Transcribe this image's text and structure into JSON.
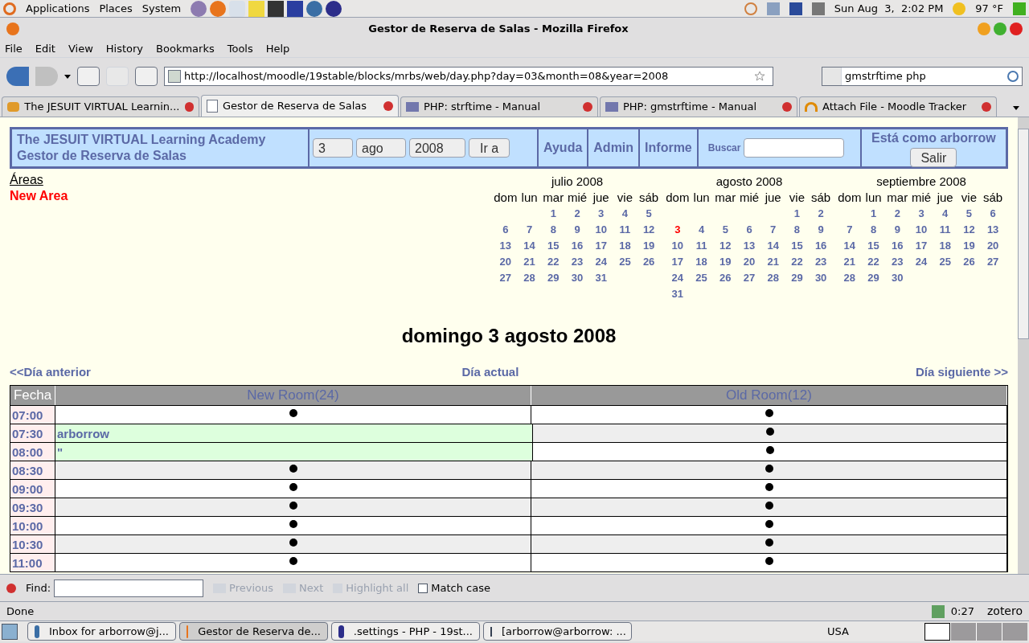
{
  "top_panel": {
    "menus": [
      "Applications",
      "Places",
      "System"
    ],
    "clock": "Sun Aug  3,  2:02 PM",
    "weather": "97 °F"
  },
  "window": {
    "title": "Gestor de Reserva de Salas - Mozilla Firefox"
  },
  "menubar": [
    "File",
    "Edit",
    "View",
    "History",
    "Bookmarks",
    "Tools",
    "Help"
  ],
  "toolbar": {
    "url": "http://localhost/moodle/19stable/blocks/mrbs/web/day.php?day=03&month=08&year=2008",
    "search_value": "gmstrftime php"
  },
  "tabs": [
    {
      "label": "The JESUIT VIRTUAL Learnin...",
      "selected": false
    },
    {
      "label": "Gestor de Reserva de Salas",
      "selected": true
    },
    {
      "label": "PHP: strftime - Manual",
      "selected": false
    },
    {
      "label": "PHP: gmstrftime - Manual",
      "selected": false
    },
    {
      "label": "Attach File - Moodle Tracker",
      "selected": false
    }
  ],
  "header": {
    "site": "The JESUIT VIRTUAL Learning Academy",
    "app": "Gestor de Reserva de Salas",
    "day": "3",
    "month": "ago",
    "year": "2008",
    "go": "Ir a",
    "links": [
      "Ayuda",
      "Admin",
      "Informe"
    ],
    "search_label": "Buscar",
    "user": "Está como arborrow",
    "logout": "Salir"
  },
  "areas": {
    "title": "Áreas",
    "items": [
      "New Area"
    ]
  },
  "calendars": [
    {
      "title": "julio 2008",
      "weekdays": [
        "dom",
        "lun",
        "mar",
        "mié",
        "jue",
        "vie",
        "sáb"
      ],
      "weeks": [
        [
          {
            "day": "1",
            "today": false
          },
          {
            "day": "2",
            "today": false
          },
          {
            "day": "3",
            "today": false
          },
          {
            "day": "4",
            "today": false
          },
          {
            "day": "5",
            "today": false
          }
        ],
        [
          {
            "day": "6",
            "today": false
          },
          {
            "day": "7",
            "today": false
          },
          {
            "day": "8",
            "today": false
          },
          {
            "day": "9",
            "today": false
          },
          {
            "day": "10",
            "today": false
          },
          {
            "day": "11",
            "today": false
          },
          {
            "day": "12",
            "today": false
          }
        ],
        [
          {
            "day": "13",
            "today": false
          },
          {
            "day": "14",
            "today": false
          },
          {
            "day": "15",
            "today": false
          },
          {
            "day": "16",
            "today": false
          },
          {
            "day": "17",
            "today": false
          },
          {
            "day": "18",
            "today": false
          },
          {
            "day": "19",
            "today": false
          }
        ],
        [
          {
            "day": "20",
            "today": false
          },
          {
            "day": "21",
            "today": false
          },
          {
            "day": "22",
            "today": false
          },
          {
            "day": "23",
            "today": false
          },
          {
            "day": "24",
            "today": false
          },
          {
            "day": "25",
            "today": false
          },
          {
            "day": "26",
            "today": false
          }
        ],
        [
          {
            "day": "27",
            "today": false
          },
          {
            "day": "28",
            "today": false
          },
          {
            "day": "29",
            "today": false
          },
          {
            "day": "30",
            "today": false
          },
          {
            "day": "31",
            "today": false
          }
        ]
      ]
    },
    {
      "title": "agosto 2008",
      "weekdays": [
        "dom",
        "lun",
        "mar",
        "mié",
        "jue",
        "vie",
        "sáb"
      ],
      "weeks": [
        [
          {
            "day": "1",
            "today": false
          },
          {
            "day": "2",
            "today": false
          }
        ],
        [
          {
            "day": "3",
            "today": true
          },
          {
            "day": "4",
            "today": false
          },
          {
            "day": "5",
            "today": false
          },
          {
            "day": "6",
            "today": false
          },
          {
            "day": "7",
            "today": false
          },
          {
            "day": "8",
            "today": false
          },
          {
            "day": "9",
            "today": false
          }
        ],
        [
          {
            "day": "10",
            "today": false
          },
          {
            "day": "11",
            "today": false
          },
          {
            "day": "12",
            "today": false
          },
          {
            "day": "13",
            "today": false
          },
          {
            "day": "14",
            "today": false
          },
          {
            "day": "15",
            "today": false
          },
          {
            "day": "16",
            "today": false
          }
        ],
        [
          {
            "day": "17",
            "today": false
          },
          {
            "day": "18",
            "today": false
          },
          {
            "day": "19",
            "today": false
          },
          {
            "day": "20",
            "today": false
          },
          {
            "day": "21",
            "today": false
          },
          {
            "day": "22",
            "today": false
          },
          {
            "day": "23",
            "today": false
          }
        ],
        [
          {
            "day": "24",
            "today": false
          },
          {
            "day": "25",
            "today": false
          },
          {
            "day": "26",
            "today": false
          },
          {
            "day": "27",
            "today": false
          },
          {
            "day": "28",
            "today": false
          },
          {
            "day": "29",
            "today": false
          },
          {
            "day": "30",
            "today": false
          }
        ],
        [
          {
            "day": "31",
            "today": false
          }
        ]
      ]
    },
    {
      "title": "septiembre 2008",
      "weekdays": [
        "dom",
        "lun",
        "mar",
        "mié",
        "jue",
        "vie",
        "sáb"
      ],
      "weeks": [
        [
          {
            "day": "1",
            "today": false
          },
          {
            "day": "2",
            "today": false
          },
          {
            "day": "3",
            "today": false
          },
          {
            "day": "4",
            "today": false
          },
          {
            "day": "5",
            "today": false
          },
          {
            "day": "6",
            "today": false
          }
        ],
        [
          {
            "day": "7",
            "today": false
          },
          {
            "day": "8",
            "today": false
          },
          {
            "day": "9",
            "today": false
          },
          {
            "day": "10",
            "today": false
          },
          {
            "day": "11",
            "today": false
          },
          {
            "day": "12",
            "today": false
          },
          {
            "day": "13",
            "today": false
          }
        ],
        [
          {
            "day": "14",
            "today": false
          },
          {
            "day": "15",
            "today": false
          },
          {
            "day": "16",
            "today": false
          },
          {
            "day": "17",
            "today": false
          },
          {
            "day": "18",
            "today": false
          },
          {
            "day": "19",
            "today": false
          },
          {
            "day": "20",
            "today": false
          }
        ],
        [
          {
            "day": "21",
            "today": false
          },
          {
            "day": "22",
            "today": false
          },
          {
            "day": "23",
            "today": false
          },
          {
            "day": "24",
            "today": false
          },
          {
            "day": "25",
            "today": false
          },
          {
            "day": "26",
            "today": false
          },
          {
            "day": "27",
            "today": false
          }
        ],
        [
          {
            "day": "28",
            "today": false
          },
          {
            "day": "29",
            "today": false
          },
          {
            "day": "30",
            "today": false
          }
        ]
      ]
    }
  ],
  "day_title": "domingo 3 agosto 2008",
  "day_nav": {
    "prev": "<<Día anterior",
    "today": "Día actual",
    "next": "Día siguiente >>"
  },
  "schedule": {
    "columns": [
      "Fecha",
      "New Room(24)",
      "Old Room(12)"
    ],
    "rows": [
      {
        "time": "07:00",
        "cells": [
          {
            "kind": "add"
          },
          {
            "kind": "add"
          }
        ]
      },
      {
        "time": "07:30",
        "cells": [
          {
            "kind": "booking",
            "text": "arborrow"
          },
          {
            "kind": "add"
          }
        ]
      },
      {
        "time": "08:00",
        "cells": [
          {
            "kind": "booking",
            "text": "\""
          },
          {
            "kind": "add"
          }
        ]
      },
      {
        "time": "08:30",
        "cells": [
          {
            "kind": "add"
          },
          {
            "kind": "add"
          }
        ]
      },
      {
        "time": "09:00",
        "cells": [
          {
            "kind": "add"
          },
          {
            "kind": "add"
          }
        ]
      },
      {
        "time": "09:30",
        "cells": [
          {
            "kind": "add"
          },
          {
            "kind": "add"
          }
        ]
      },
      {
        "time": "10:00",
        "cells": [
          {
            "kind": "add"
          },
          {
            "kind": "add"
          }
        ]
      },
      {
        "time": "10:30",
        "cells": [
          {
            "kind": "add"
          },
          {
            "kind": "add"
          }
        ]
      },
      {
        "time": "11:00",
        "cells": [
          {
            "kind": "add"
          },
          {
            "kind": "add"
          }
        ]
      }
    ]
  },
  "findbar": {
    "label": "Find:",
    "previous": "Previous",
    "next": "Next",
    "highlight": "Highlight all",
    "match_case": "Match case",
    "match_case_checked": false
  },
  "status_bar": {
    "text": "Done",
    "timer": "0:27",
    "zotero": "zotero"
  },
  "taskbar": {
    "items": [
      {
        "label": "Inbox for arborrow@j...",
        "selected": false
      },
      {
        "label": "Gestor de Reserva de...",
        "selected": true
      },
      {
        "label": ".settings - PHP - 19st...",
        "selected": false
      },
      {
        "label": "[arborrow@arborrow: ...",
        "selected": false
      }
    ],
    "keyboard": "USA"
  }
}
